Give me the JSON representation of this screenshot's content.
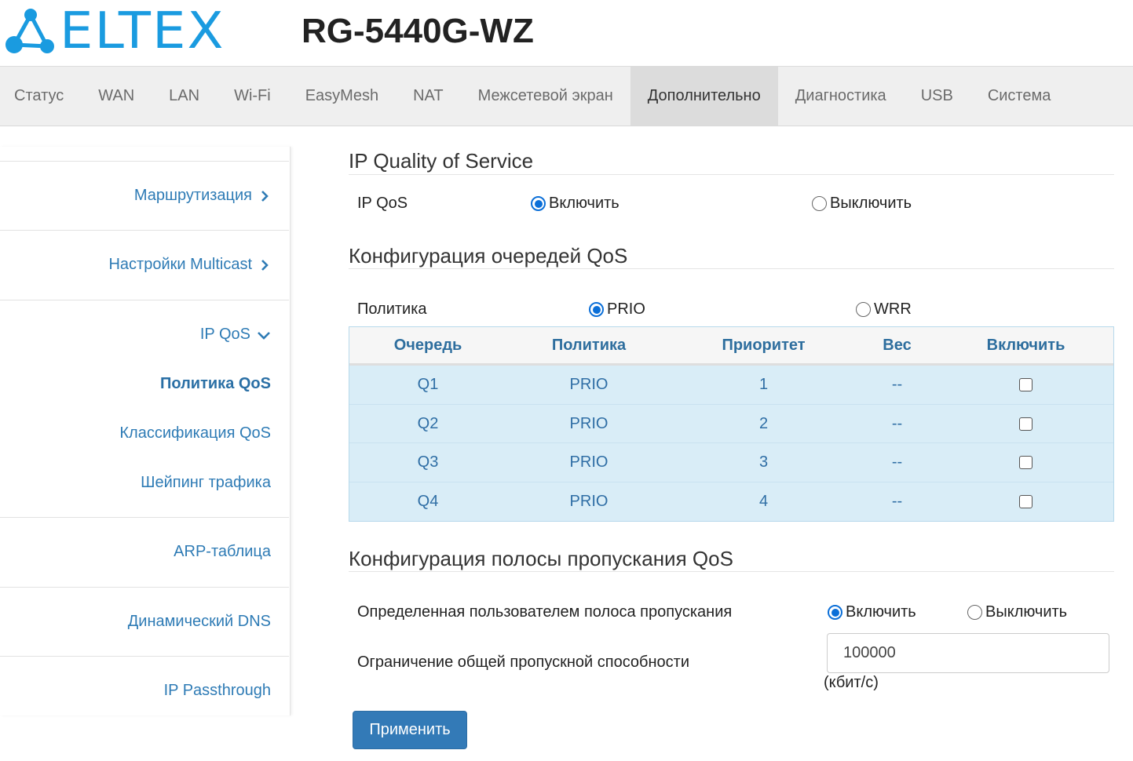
{
  "brand": {
    "logo_text": "ELTEX",
    "model": "RG-5440G-WZ",
    "accent": "#1a9be0"
  },
  "topnav": {
    "tabs": [
      {
        "label": "Статус",
        "active": false
      },
      {
        "label": "WAN",
        "active": false
      },
      {
        "label": "LAN",
        "active": false
      },
      {
        "label": "Wi-Fi",
        "active": false
      },
      {
        "label": "EasyMesh",
        "active": false
      },
      {
        "label": "NAT",
        "active": false
      },
      {
        "label": "Межсетевой экран",
        "active": false
      },
      {
        "label": "Дополнительно",
        "active": true
      },
      {
        "label": "Диагностика",
        "active": false
      },
      {
        "label": "USB",
        "active": false
      },
      {
        "label": "Система",
        "active": false
      }
    ]
  },
  "sidebar": {
    "routing": "Маршрутизация",
    "multicast": "Настройки Multicast",
    "ipqos": "IP QoS",
    "sub": {
      "policy": "Политика QoS",
      "classification": "Классификация QoS",
      "shaping": "Шейпинг трафика"
    },
    "arp": "ARP-таблица",
    "ddns": "Динамический DNS",
    "passthrough": "IP Passthrough"
  },
  "main": {
    "qos_title": "IP Quality of Service",
    "ipqos_label": "IP QoS",
    "enable": "Включить",
    "disable": "Выключить",
    "queue_title": "Конфигурация очередей QoS",
    "policy_label": "Политика",
    "policy_prio": "PRIO",
    "policy_wrr": "WRR",
    "table": {
      "headers": [
        "Очередь",
        "Политика",
        "Приоритет",
        "Вес",
        "Включить"
      ],
      "rows": [
        {
          "queue": "Q1",
          "policy": "PRIO",
          "priority": "1",
          "weight": "--",
          "enabled": false
        },
        {
          "queue": "Q2",
          "policy": "PRIO",
          "priority": "2",
          "weight": "--",
          "enabled": false
        },
        {
          "queue": "Q3",
          "policy": "PRIO",
          "priority": "3",
          "weight": "--",
          "enabled": false
        },
        {
          "queue": "Q4",
          "policy": "PRIO",
          "priority": "4",
          "weight": "--",
          "enabled": false
        }
      ]
    },
    "bw_title": "Конфигурация полосы пропускания QoS",
    "bw_user_label": "Определенная пользователем полоса пропускания",
    "bw_limit_label": "Ограничение общей пропускной способности",
    "bw_value": "100000",
    "bw_unit": "(кбит/с)",
    "apply": "Применить"
  }
}
